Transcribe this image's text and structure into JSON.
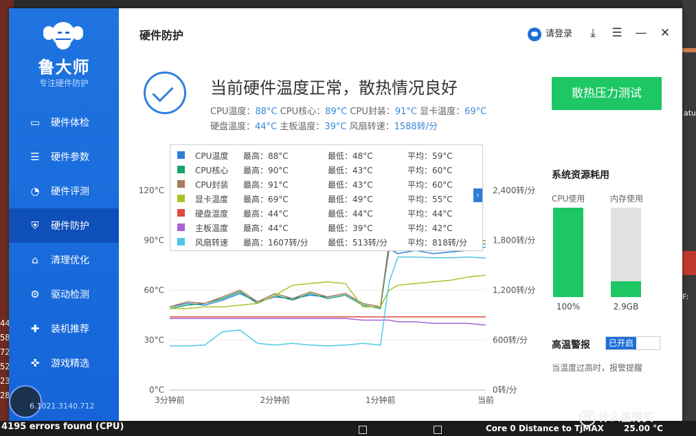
{
  "background": {
    "left_lines": [
      "44",
      "58",
      "72",
      "52",
      "23",
      "28"
    ],
    "right_label": "atu",
    "right_label2": "F:",
    "taskbar_error": "4195 errors found (CPU)",
    "taskbar_core": "Core 0 Distance to TjMAX",
    "taskbar_temp": "25.00 °C",
    "watermark": "什么值得买",
    "watermark_icon": "值"
  },
  "sidebar": {
    "app_name": "鲁大师",
    "slogan": "专注硬件防护",
    "items": [
      {
        "label": "硬件体检",
        "icon": "monitor-icon",
        "glyph": "▭"
      },
      {
        "label": "硬件参数",
        "icon": "list-icon",
        "glyph": "☰"
      },
      {
        "label": "硬件评测",
        "icon": "gauge-icon",
        "glyph": "◔"
      },
      {
        "label": "硬件防护",
        "icon": "shield-icon",
        "glyph": "⛨",
        "active": true
      },
      {
        "label": "清理优化",
        "icon": "broom-icon",
        "glyph": "⌂"
      },
      {
        "label": "驱动检测",
        "icon": "gear-icon",
        "glyph": "⚙"
      },
      {
        "label": "装机推荐",
        "icon": "grid-icon",
        "glyph": "✚"
      },
      {
        "label": "游戏精选",
        "icon": "gamepad-icon",
        "glyph": "✜"
      }
    ],
    "version": "6.1021.3140.712"
  },
  "header": {
    "title": "硬件防护",
    "login": "请登录",
    "icons": [
      "download-icon",
      "menu-icon",
      "minimize-icon",
      "close-icon"
    ]
  },
  "status": {
    "headline": "当前硬件温度正常，散热情况良好",
    "row1": [
      {
        "label": "CPU温度：",
        "value": "88°C"
      },
      {
        "label": "CPU核心：",
        "value": "89°C"
      },
      {
        "label": "CPU封装：",
        "value": "91°C"
      },
      {
        "label": "显卡温度：",
        "value": "69°C"
      }
    ],
    "row2": [
      {
        "label": "硬盘温度：",
        "value": "44°C"
      },
      {
        "label": "主板温度：",
        "value": "39°C"
      },
      {
        "label": "风扇转速：",
        "value": "1588转/分"
      }
    ]
  },
  "stress_button": "散热压力测试",
  "legend": [
    {
      "name": "CPU温度",
      "max": "最高：88°C",
      "min": "最低：48°C",
      "avg": "平均：59°C",
      "color": "#2f7fd9"
    },
    {
      "name": "CPU核心",
      "max": "最高：90°C",
      "min": "最低：43°C",
      "avg": "平均：60°C",
      "color": "#16a36a"
    },
    {
      "name": "CPU封装",
      "max": "最高：91°C",
      "min": "最低：43°C",
      "avg": "平均：60°C",
      "color": "#a8795a"
    },
    {
      "name": "显卡温度",
      "max": "最高：69°C",
      "min": "最低：49°C",
      "avg": "平均：55°C",
      "color": "#a8c42b"
    },
    {
      "name": "硬盘温度",
      "max": "最高：44°C",
      "min": "最低：44°C",
      "avg": "平均：44°C",
      "color": "#e0493f"
    },
    {
      "name": "主板温度",
      "max": "最高：44°C",
      "min": "最低：39°C",
      "avg": "平均：42°C",
      "color": "#a862d6"
    },
    {
      "name": "风扇转速",
      "max": "最高：1607转/分",
      "min": "最低：513转/分",
      "avg": "平均：818转/分",
      "color": "#4ec8e6"
    }
  ],
  "legend_toggle": "‹",
  "chart_data": {
    "type": "line",
    "x_ticks": [
      "3分钟前",
      "2分钟前",
      "1分钟前",
      "当前"
    ],
    "y_left_ticks": [
      "0°C",
      "30°C",
      "60°C",
      "90°C",
      "120°C"
    ],
    "y_left_range": [
      0,
      120
    ],
    "y_right_ticks": [
      "0转/分",
      "600转/分",
      "1,200转/分",
      "1,800转/分",
      "2,400转/分"
    ],
    "y_right_range": [
      0,
      2400
    ],
    "x": [
      0,
      10,
      20,
      30,
      40,
      50,
      60,
      70,
      80,
      90,
      100,
      110,
      120,
      125,
      130,
      140,
      150,
      160,
      170,
      180
    ],
    "series": [
      {
        "name": "CPU温度",
        "axis": "left",
        "color": "#2f7fd9",
        "values": [
          50,
          52,
          51,
          54,
          58,
          53,
          56,
          55,
          57,
          56,
          58,
          52,
          50,
          85,
          82,
          84,
          82,
          83,
          84,
          86
        ]
      },
      {
        "name": "CPU核心",
        "axis": "left",
        "color": "#16a36a",
        "values": [
          49,
          51,
          52,
          55,
          59,
          52,
          57,
          54,
          58,
          55,
          57,
          51,
          49,
          87,
          84,
          86,
          84,
          85,
          86,
          88
        ]
      },
      {
        "name": "CPU封装",
        "axis": "left",
        "color": "#a8795a",
        "values": [
          50,
          53,
          52,
          56,
          60,
          53,
          58,
          55,
          59,
          56,
          58,
          52,
          50,
          89,
          86,
          88,
          86,
          87,
          88,
          90
        ]
      },
      {
        "name": "显卡温度",
        "axis": "left",
        "color": "#a8c42b",
        "values": [
          49,
          49,
          50,
          50,
          51,
          52,
          57,
          63,
          64,
          65,
          64,
          50,
          50,
          60,
          63,
          64,
          65,
          66,
          68,
          69
        ]
      },
      {
        "name": "硬盘温度",
        "axis": "left",
        "color": "#e0493f",
        "values": [
          44,
          44,
          44,
          44,
          44,
          44,
          44,
          44,
          44,
          44,
          44,
          44,
          44,
          44,
          44,
          44,
          44,
          44,
          44,
          44
        ]
      },
      {
        "name": "主板温度",
        "axis": "left",
        "color": "#a862d6",
        "values": [
          43,
          43,
          43,
          43,
          43,
          43,
          43,
          43,
          43,
          43,
          43,
          42,
          42,
          42,
          41,
          41,
          40,
          40,
          40,
          39
        ]
      },
      {
        "name": "风扇转速",
        "axis": "right",
        "color": "#4ec8e6",
        "values": [
          530,
          530,
          540,
          700,
          720,
          560,
          540,
          560,
          540,
          530,
          540,
          560,
          540,
          1300,
          1600,
          1600,
          1590,
          1590,
          1600,
          1588
        ]
      }
    ]
  },
  "resources": {
    "title": "系统资源耗用",
    "cpu_label": "CPU使用",
    "mem_label": "内存使用",
    "cpu_value": "100%",
    "mem_value": "2.9GB",
    "cpu_fraction": 1.0,
    "mem_fraction": 0.18
  },
  "alarm": {
    "title": "高温警报",
    "toggle": "已开启",
    "desc": "当温度过高时，报警提醒"
  }
}
